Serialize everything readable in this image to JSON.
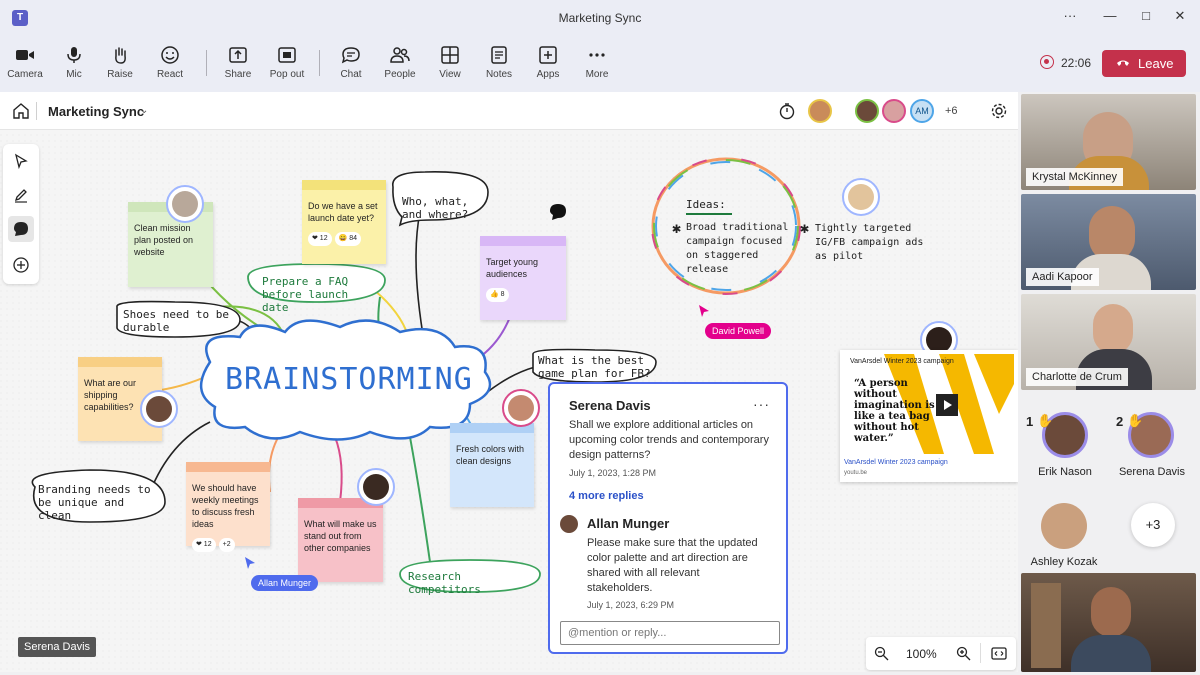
{
  "window": {
    "title": "Marketing Sync",
    "more": "···",
    "minimize": "—",
    "maximize": "□",
    "close": "✕"
  },
  "toolbar": {
    "buttons": [
      {
        "label": "Camera",
        "icon": "camera-icon"
      },
      {
        "label": "Mic",
        "icon": "mic-icon"
      },
      {
        "label": "Raise",
        "icon": "raise-hand-icon"
      },
      {
        "label": "React",
        "icon": "react-icon"
      },
      {
        "label": "Share",
        "icon": "share-icon"
      },
      {
        "label": "Pop out",
        "icon": "pop-out-icon"
      },
      {
        "label": "Chat",
        "icon": "chat-icon"
      },
      {
        "label": "People",
        "icon": "people-icon"
      },
      {
        "label": "View",
        "icon": "view-icon"
      },
      {
        "label": "Notes",
        "icon": "notes-icon"
      },
      {
        "label": "Apps",
        "icon": "apps-icon"
      },
      {
        "label": "More",
        "icon": "more-icon"
      }
    ],
    "timer": "22:06",
    "leave_label": "Leave",
    "colors": {
      "leave": "#c4314b",
      "accent": "#5b5fc7"
    }
  },
  "board": {
    "title": "Marketing Sync",
    "participants_more": "+6",
    "avatar_initials": "AM",
    "center_text": "BRAINSTORMING",
    "stickies": [
      {
        "text": "Clean mission plan posted on website",
        "color": "#dff0d0"
      },
      {
        "text": "Do we have a set launch date yet?",
        "color": "#fbf1a9",
        "reactions": [
          "❤ 12",
          "😄 84"
        ]
      },
      {
        "text": "Target young audiences",
        "color": "#ead7fb",
        "reactions": [
          "👍 8"
        ]
      },
      {
        "text": "What are our shipping capabilities?",
        "color": "#fde2b3"
      },
      {
        "text": "We should have weekly meetings to discuss fresh ideas",
        "color": "#fde0cc",
        "reactions": [
          "❤ 12",
          "+2"
        ]
      },
      {
        "text": "What will make us stand out from other companies",
        "color": "#f7c1c8"
      },
      {
        "text": "Fresh colors with clean designs",
        "color": "#d3e6fb"
      }
    ],
    "handwriting": [
      "Who, what, and where?",
      "Prepare a FAQ before launch date",
      "Shoes need to be durable",
      "What is the best game plan for FB?",
      "Branding needs to be unique and clean",
      "Research competitors",
      "Ideas:",
      "Broad traditional campaign focused on staggered release",
      "Tightly targeted IG/FB campaign ads as pilot"
    ],
    "cursors": [
      "David Powell",
      "Allan Munger"
    ],
    "video": {
      "title": "VanArsdel Winter 2023 campaign",
      "quote": "“A person without imagination is like a tea bag without hot water.”",
      "link": "VanArsdel Winter 2023 campaign",
      "source": "youtu.be"
    },
    "zoom": "100%",
    "presenter": "Serena Davis"
  },
  "comment": {
    "author": "Serena Davis",
    "text": "Shall we explore additional articles on upcoming color trends and contemporary design patterns?",
    "date": "July 1, 2023, 1:28 PM",
    "more_replies": "4 more replies",
    "reply_author": "Allan Munger",
    "reply_text": "Please make sure that the updated color palette and art direction are shared with all relevant stakeholders.",
    "reply_date": "July 1, 2023, 6:29 PM",
    "placeholder": "@mention or reply..."
  },
  "participants": {
    "tiles": [
      "Krystal McKinney",
      "Aadi Kapoor",
      "Charlotte de Crum"
    ],
    "raised": [
      {
        "name": "Erik Nason",
        "order": "1"
      },
      {
        "name": "Serena Davis",
        "order": "2"
      }
    ],
    "others": [
      "Ashley Kozak"
    ],
    "overflow": "+3"
  }
}
